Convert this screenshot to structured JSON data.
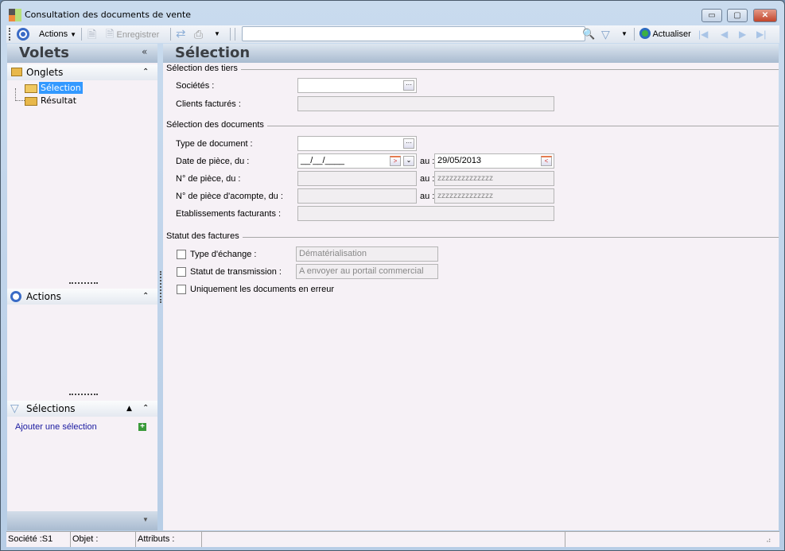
{
  "window": {
    "title": "Consultation des documents de vente",
    "minimize": "▭",
    "maximize": "▢",
    "close": "✕"
  },
  "toolbar": {
    "actions": "Actions",
    "save": "Enregistrer",
    "search_value": "",
    "refresh": "Actualiser"
  },
  "left": {
    "title": "Volets",
    "collapse": "«",
    "onglets": {
      "title": "Onglets",
      "items": [
        "Sélection",
        "Résultat"
      ]
    },
    "actions": {
      "title": "Actions"
    },
    "selections": {
      "title": "Sélections",
      "add": "Ajouter une sélection"
    }
  },
  "main": {
    "title": "Sélection",
    "tiers": {
      "legend": "Sélection des tiers",
      "societes": "Sociétés :",
      "clients": "Clients facturés :"
    },
    "documents": {
      "legend": "Sélection des documents",
      "type": "Type de document :",
      "date": "Date de pièce, du :",
      "date_from": "__/__/____",
      "au": "au :",
      "date_to": "29/05/2013",
      "num": "N° de pièce, du :",
      "num_to": "zzzzzzzzzzzzzz",
      "acompte": "N° de pièce d'acompte, du :",
      "acompte_to": "zzzzzzzzzzzzzz",
      "etab": "Etablissements facturants :"
    },
    "statut": {
      "legend": "Statut des factures",
      "echange": "Type d'échange :",
      "echange_value": "Dématérialisation",
      "transmission": "Statut de transmission :",
      "transmission_value": "A envoyer au portail commercial",
      "erreur": "Uniquement les documents en erreur"
    }
  },
  "status": {
    "societe": "Société :S1",
    "objet": "Objet :",
    "attributs": "Attributs :"
  }
}
